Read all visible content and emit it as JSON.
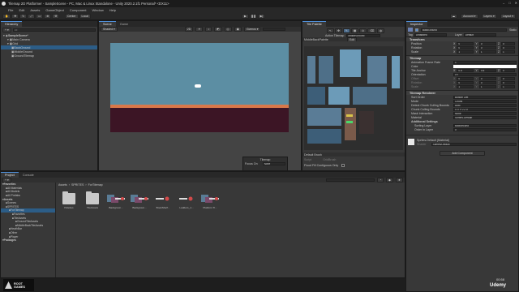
{
  "window": {
    "title": "Tilemap 2D Platformer - SampleScene - PC, Mac & Linux Standalone - Unity 2020.2.1f1 Personal* <DX11>"
  },
  "menu": [
    "File",
    "Edit",
    "Assets",
    "GameObject",
    "Component",
    "Window",
    "Help"
  ],
  "toolbar": {
    "pivot": "Center",
    "space": "Local",
    "account": "Account",
    "layers": "Layers",
    "layout": "Layout"
  },
  "hierarchy": {
    "tab": "Hierarchy",
    "search_placeholder": "All",
    "items": [
      {
        "label": "SampleScene*",
        "level": 0,
        "selected": false
      },
      {
        "label": "Main Camera",
        "level": 1,
        "selected": false
      },
      {
        "label": "Grid",
        "level": 1,
        "selected": false
      },
      {
        "label": "BackGround",
        "level": 2,
        "selected": true
      },
      {
        "label": "MiddleGround",
        "level": 2,
        "selected": false
      },
      {
        "label": "GroundTilemap",
        "level": 2,
        "selected": false
      }
    ]
  },
  "scene": {
    "tabs": [
      "Scene",
      "Game"
    ],
    "shading": "Shaded",
    "mode_2d": "2D",
    "gizmos": "Gizmos",
    "overlay": {
      "title": "Tilemap",
      "focus_label": "Focus On",
      "focus_value": "None"
    },
    "colors": {
      "sky": "#5c8ea3",
      "ground": "#3c1525",
      "ledge": "#d8784a"
    }
  },
  "tile_palette": {
    "tab": "Tile Palette",
    "active_tilemap_label": "Active Tilemap",
    "active_tilemap_value": "MiddleGround",
    "palette_name": "MiddleBackPalette",
    "edit_label": "Edit",
    "default_brush": "Default Brush",
    "script_label": "Script",
    "script_value": "GridBrush",
    "flood_fill": "Flood Fill Contiguous Only"
  },
  "project": {
    "tabs": [
      "Project",
      "Console"
    ],
    "breadcrumb": [
      "Assets",
      "SPRITES",
      "ForTilemap"
    ],
    "tree": [
      {
        "label": "Favorites",
        "level": 0,
        "bold": true
      },
      {
        "label": "All Materials",
        "level": 1
      },
      {
        "label": "All Models",
        "level": 1
      },
      {
        "label": "All Prefabs",
        "level": 1
      },
      {
        "label": "Assets",
        "level": 0,
        "bold": true
      },
      {
        "label": "Scenes",
        "level": 1
      },
      {
        "label": "SPRITES",
        "level": 1
      },
      {
        "label": "ForTilemap",
        "level": 2,
        "selected": true
      },
      {
        "label": "Favorites",
        "level": 3
      },
      {
        "label": "TileAssets",
        "level": 3
      },
      {
        "label": "GroundTileAssets",
        "level": 4
      },
      {
        "label": "MiddleBackTileAssets",
        "level": 4
      },
      {
        "label": "HeathBar",
        "level": 2
      },
      {
        "label": "Other",
        "level": 2
      },
      {
        "label": "Player",
        "level": 2
      },
      {
        "label": "Packages",
        "level": 0,
        "bold": true
      }
    ],
    "assets": [
      {
        "name": "Palettes",
        "kind": "folder"
      },
      {
        "name": "TileAssets",
        "kind": "folder"
      },
      {
        "name": "Backgroun...",
        "kind": "sheet"
      },
      {
        "name": "Backgroun...",
        "kind": "sheet"
      },
      {
        "name": "BookShelf...",
        "kind": "sprite"
      },
      {
        "name": "Ladders_1...",
        "kind": "sprite"
      },
      {
        "name": "Platform Ti...",
        "kind": "sheet"
      }
    ],
    "slider_count": "14"
  },
  "inspector": {
    "tab": "Inspector",
    "object_name": "BackGround",
    "static_label": "Static",
    "tag_label": "Tag",
    "tag_value": "Untagged",
    "layer_label": "Layer",
    "layer_value": "Default",
    "transform": {
      "title": "Transform",
      "rows": [
        {
          "label": "Position",
          "x": "0",
          "y": "0",
          "z": "0"
        },
        {
          "label": "Rotation",
          "x": "0",
          "y": "0",
          "z": "0"
        },
        {
          "label": "Scale",
          "x": "1",
          "y": "1",
          "z": "1"
        }
      ]
    },
    "tilemap": {
      "title": "Tilemap",
      "animation_frame_rate_label": "Animation Frame Rate",
      "animation_frame_rate": "1",
      "color_label": "Color",
      "tile_anchor_label": "Tile Anchor",
      "tile_anchor": {
        "x": "0.5",
        "y": "0.5",
        "z": "0"
      },
      "orientation_label": "Orientation",
      "orientation": "XY",
      "offset_label": "Offset",
      "rotation_label": "Rotation",
      "scale_label": "Scale",
      "offset": {
        "x": "0",
        "y": "0",
        "z": "0"
      },
      "rotation": {
        "x": "0",
        "y": "0",
        "z": "0"
      },
      "scale": {
        "x": "1",
        "y": "1",
        "z": "1"
      }
    },
    "renderer": {
      "title": "Tilemap Renderer",
      "rows": [
        {
          "label": "Sort Order",
          "value": "Bottom Left"
        },
        {
          "label": "Mode",
          "value": "Chunk"
        },
        {
          "label": "Detect Chunk Culling Bounds",
          "value": "Auto"
        },
        {
          "label": "Chunk Culling Bounds",
          "value": "X 0  Y 0  Z 0"
        },
        {
          "label": "Mask Interaction",
          "value": "None"
        },
        {
          "label": "Material",
          "value": "Sprites-Default"
        }
      ],
      "additional_settings": "Additional Settings",
      "sorting_layer_label": "Sorting Layer",
      "sorting_layer": "Background",
      "order_label": "Order in Layer",
      "order": "0"
    },
    "material": {
      "name": "Sprites-Default (Material)",
      "shader_label": "Shader",
      "shader": "Sprites/Default"
    },
    "add_component": "Add Component"
  },
  "branding": {
    "logo": "ROOT GAMES",
    "udemy": "Udemy",
    "time": "00:58"
  }
}
